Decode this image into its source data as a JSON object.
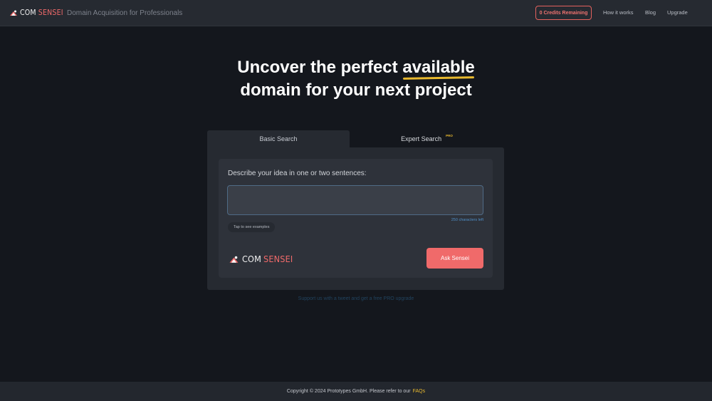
{
  "header": {
    "brand": {
      "com": "COM",
      "sensei": "SENSEI"
    },
    "tagline": "Domain Acquisition for Professionals",
    "credits_label": "0 Credits Remaining",
    "nav": [
      "How it works",
      "Blog",
      "Upgrade"
    ]
  },
  "hero": {
    "line1_prefix": "Uncover the perfect",
    "highlight": "available",
    "line2": "domain for your next project"
  },
  "search": {
    "tabs": [
      {
        "label": "Basic Search",
        "active": true
      },
      {
        "label": "Expert Search",
        "badge": "PRO",
        "active": false
      }
    ],
    "prompt_label": "Describe your idea in one or two sentences:",
    "input_value": "",
    "chars_left": "250 characters left",
    "examples_label": "Tap to see examples",
    "brand": {
      "com": "COM",
      "sensei": "SENSEI"
    },
    "submit_label": "Ask Sensei"
  },
  "support_text": "Support us with a tweet and get a free PRO upgrade",
  "footer": {
    "text": "Copyright © 2024 Prototypes GmbH. Please refer to our",
    "link": "FAQs"
  },
  "colors": {
    "accent": "#f06a6a",
    "highlight": "#e8b92f",
    "background": "#14171d",
    "panel": "#262a31"
  }
}
